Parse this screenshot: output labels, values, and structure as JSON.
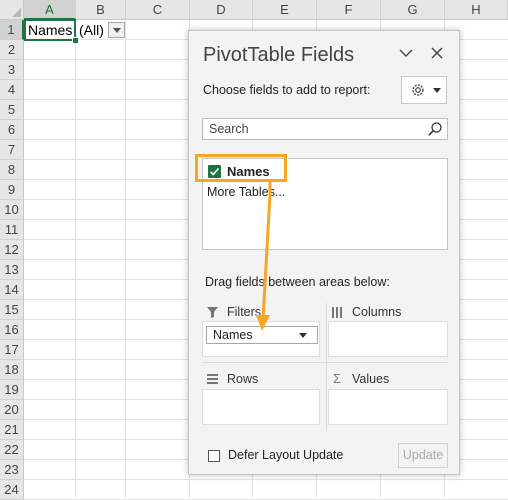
{
  "sheet": {
    "columns": [
      "A",
      "B",
      "C",
      "D",
      "E",
      "F",
      "G",
      "H"
    ],
    "rows": [
      "1",
      "2",
      "3",
      "4",
      "5",
      "6",
      "7",
      "8",
      "9",
      "10",
      "11",
      "12",
      "13",
      "14",
      "15",
      "16",
      "17",
      "18",
      "19",
      "20",
      "21",
      "22",
      "23",
      "24"
    ],
    "cells": {
      "A1": "Names",
      "B1": "(All)"
    }
  },
  "pane": {
    "title": "PivotTable Fields",
    "choose_label": "Choose fields to add to report:",
    "search_placeholder": "Search",
    "field": "Names",
    "more_tables": "More Tables...",
    "drag_label": "Drag fields between areas below:",
    "areas": {
      "filters": "Filters",
      "columns": "Columns",
      "rows": "Rows",
      "values": "Values"
    },
    "filter_item": "Names",
    "defer_label": "Defer Layout Update",
    "update_label": "Update"
  },
  "colors": {
    "excel_green": "#217346",
    "highlight_orange": "#f5a623"
  },
  "icons": [
    "chevron-down-icon",
    "close-icon",
    "gear-icon",
    "dropdown-icon",
    "search-icon",
    "checkbox-checked-icon",
    "filter-icon",
    "columns-icon",
    "rows-icon",
    "sigma-icon"
  ]
}
